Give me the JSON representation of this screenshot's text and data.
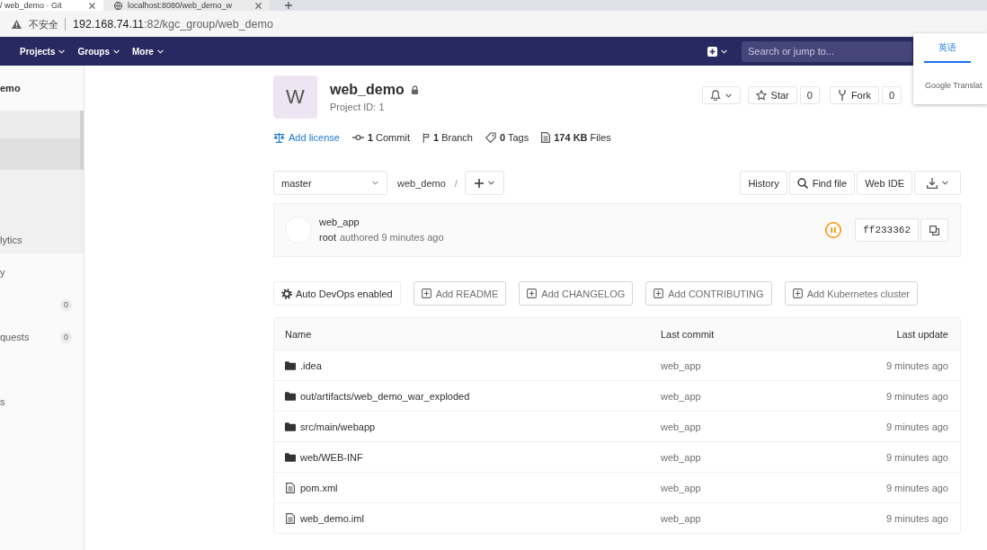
{
  "browser": {
    "tabs": [
      {
        "title": "/ web_demo · Git",
        "selected": true
      },
      {
        "title": "localhost:8080/web_demo_w",
        "selected": false,
        "favicon": true
      }
    ],
    "security_label": "不安全",
    "url": {
      "host": "192.168.74.11",
      "path": ":82/kgc_group/web_demo"
    }
  },
  "navbar": {
    "menus": [
      "Projects",
      "Groups",
      "More"
    ],
    "search": {
      "placeholder": "Search or jump to..."
    }
  },
  "translate_popup": {
    "tabs": [
      {
        "label": "英语",
        "selected": true
      }
    ],
    "brand": "Google Translat"
  },
  "sidebar": {
    "project_name": "emo",
    "items": [
      {
        "selected": true,
        "children": [
          {
            "selected": true
          },
          {
            "selected": false
          },
          {
            "selected": false
          },
          {
            "label": "lytics",
            "selected": false
          }
        ]
      },
      {
        "label": "y",
        "selected": false
      },
      {
        "count": "0",
        "selected": false
      },
      {
        "label": "quests",
        "count": "0",
        "selected": false
      },
      {
        "selected": false
      },
      {
        "label": "s",
        "selected": false
      }
    ]
  },
  "project": {
    "avatar_letter": "W",
    "name": "web_demo",
    "id_text": "Project ID: 1",
    "star": {
      "label": "Star",
      "count": "0"
    },
    "fork": {
      "label": "Fork",
      "count": "0"
    }
  },
  "stats": [
    {
      "kind": "license",
      "label": "Add license"
    },
    {
      "kind": "commits",
      "value": "1",
      "label": "Commit"
    },
    {
      "kind": "branches",
      "value": "1",
      "label": "Branch"
    },
    {
      "kind": "tags",
      "value": "0",
      "label": "Tags"
    },
    {
      "kind": "files",
      "value": "174 KB",
      "label": "Files"
    }
  ],
  "toolbar": {
    "branch": "master",
    "breadcrumb": "web_demo",
    "separator": "/",
    "buttons": [
      {
        "kind": "text",
        "label": "History"
      },
      {
        "kind": "search",
        "label": "Find file"
      },
      {
        "kind": "text",
        "label": "Web IDE"
      },
      {
        "kind": "download"
      }
    ]
  },
  "commit": {
    "title": "web_app",
    "author": "root",
    "meta": "authored 9 minutes ago",
    "sha": "ff233362"
  },
  "quick_actions": [
    {
      "kind": "enabled",
      "label": "Auto DevOps enabled"
    },
    {
      "kind": "add",
      "label": "Add README"
    },
    {
      "kind": "add",
      "label": "Add CHANGELOG"
    },
    {
      "kind": "add",
      "label": "Add CONTRIBUTING"
    },
    {
      "kind": "add",
      "label": "Add Kubernetes cluster"
    }
  ],
  "table": {
    "columns": [
      "Name",
      "Last commit",
      "Last update"
    ],
    "rows": [
      {
        "kind": "folder",
        "name": ".idea",
        "last_commit": "web_app",
        "last_update": "9 minutes ago"
      },
      {
        "kind": "folder",
        "name": "out/artifacts/web_demo_war_exploded",
        "last_commit": "web_app",
        "last_update": "9 minutes ago"
      },
      {
        "kind": "folder",
        "name": "src/main/webapp",
        "last_commit": "web_app",
        "last_update": "9 minutes ago"
      },
      {
        "kind": "folder",
        "name": "web/WEB-INF",
        "last_commit": "web_app",
        "last_update": "9 minutes ago"
      },
      {
        "kind": "file",
        "name": "pom.xml",
        "last_commit": "web_app",
        "last_update": "9 minutes ago"
      },
      {
        "kind": "file",
        "name": "web_demo.iml",
        "last_commit": "web_app",
        "last_update": "9 minutes ago"
      }
    ]
  }
}
